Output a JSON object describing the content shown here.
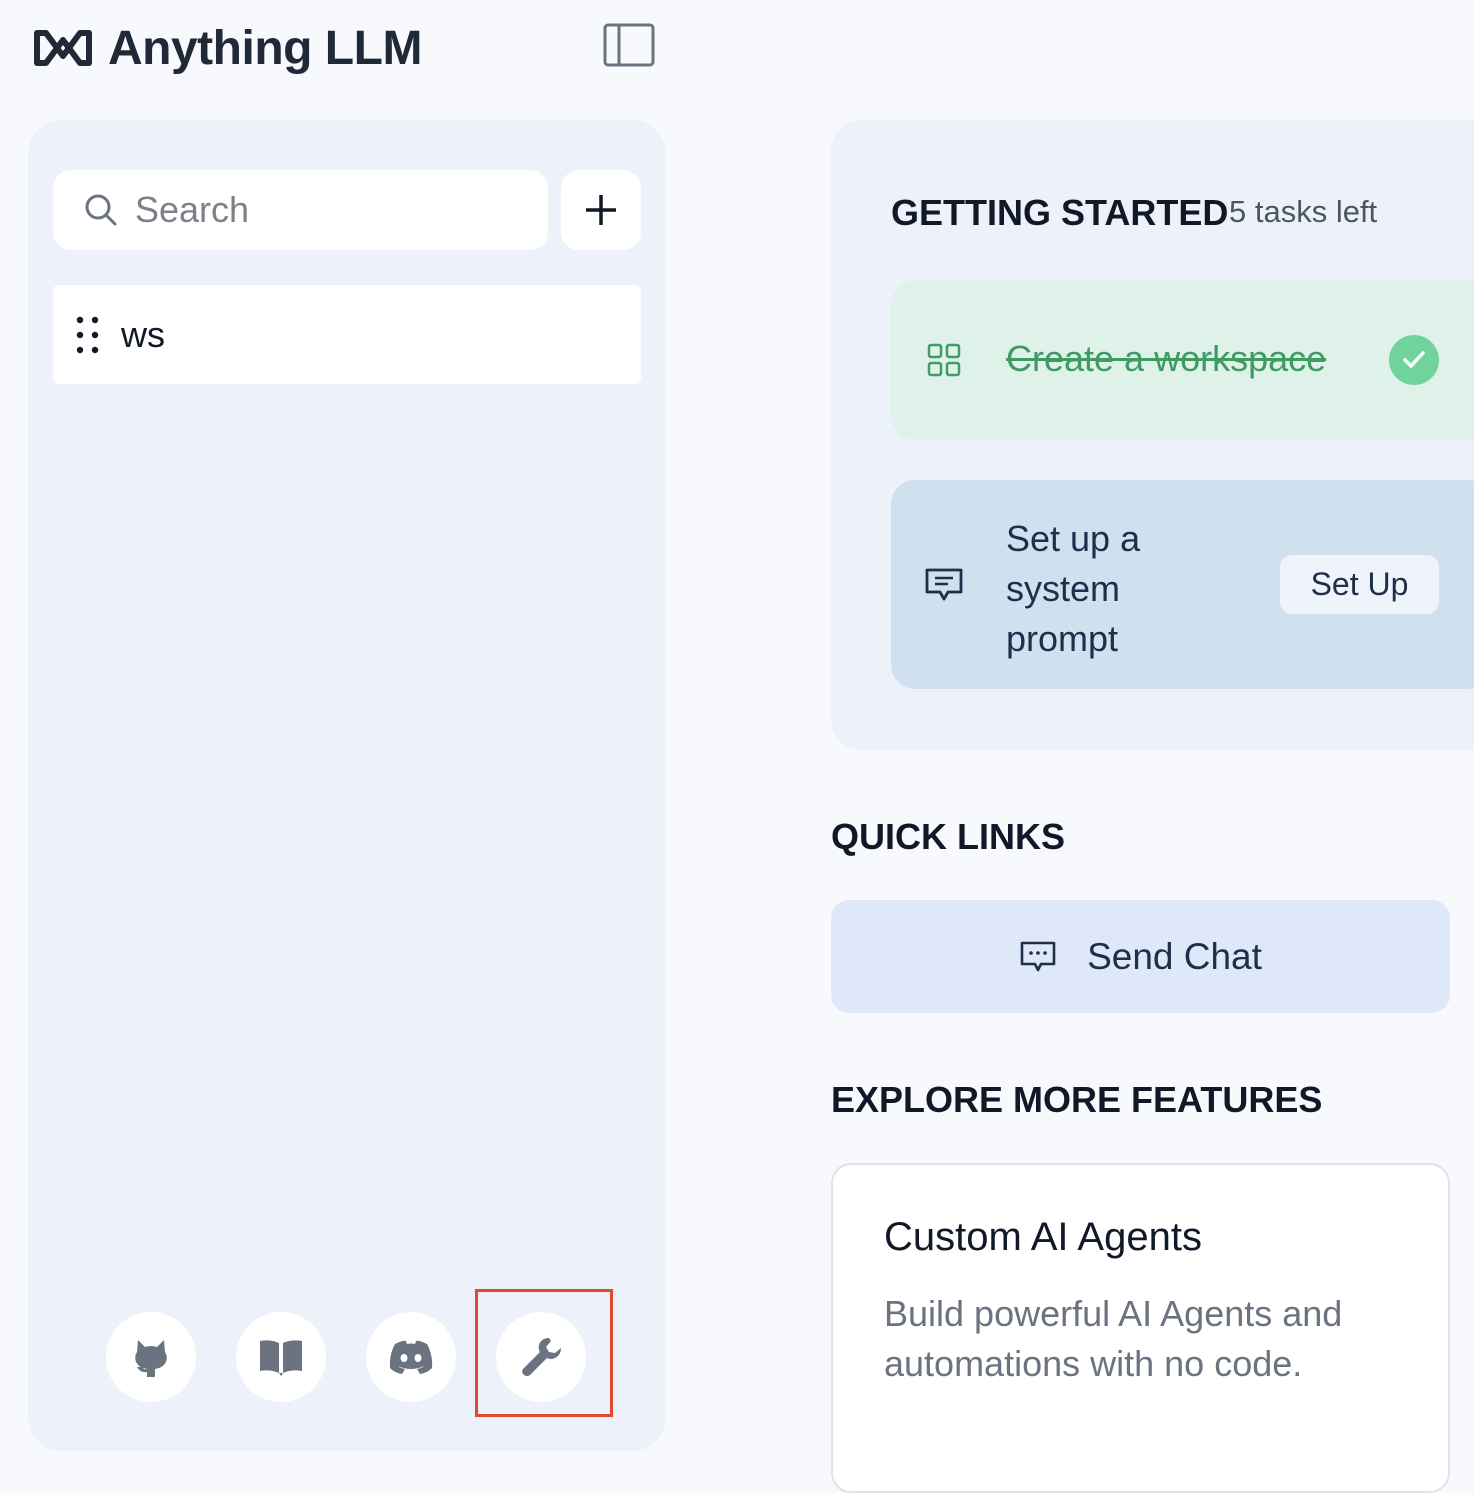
{
  "app": {
    "logo_text": "Anything LLM"
  },
  "sidebar": {
    "search_placeholder": "Search",
    "workspaces": [
      {
        "label": "ws"
      }
    ],
    "footer_icons": [
      "github-icon",
      "docs-book-icon",
      "discord-icon",
      "settings-wrench-icon"
    ]
  },
  "getting_started": {
    "title": "GETTING STARTED",
    "tasks_left": "5 tasks left",
    "tasks": [
      {
        "label": "Create a workspace",
        "done": true
      },
      {
        "label": "Set up a system prompt",
        "done": false,
        "action": "Set Up"
      }
    ]
  },
  "quick_links": {
    "title": "QUICK LINKS",
    "send_chat": "Send Chat"
  },
  "explore": {
    "title": "EXPLORE MORE FEATURES",
    "card_title": "Custom AI Agents",
    "card_desc": "Build powerful AI Agents and automations with no code."
  },
  "colors": {
    "accent_green": "#6fd39b",
    "done_bg": "#dff2e9",
    "todo_bg": "#cfe0ee",
    "highlight": "#e04a2f"
  }
}
